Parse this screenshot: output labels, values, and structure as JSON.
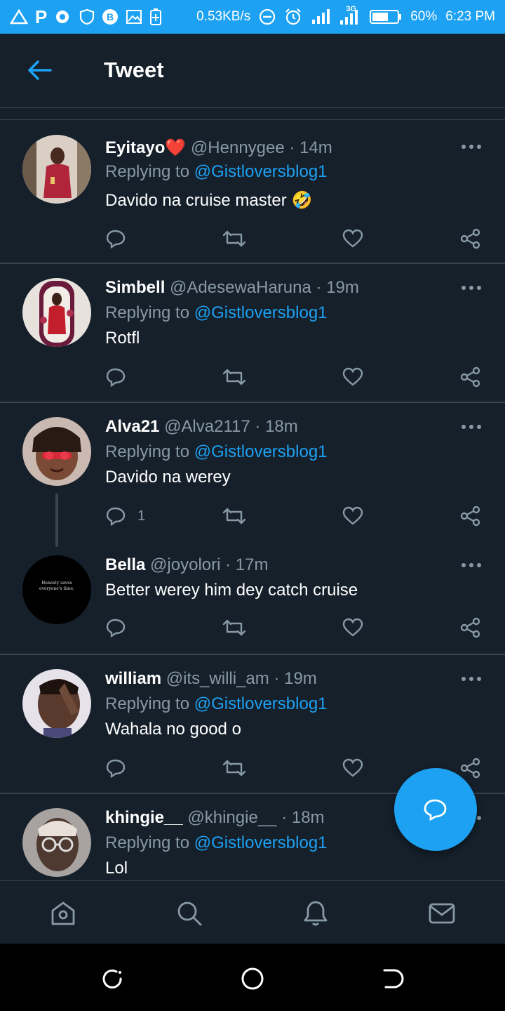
{
  "status_bar": {
    "net_speed": "0.53KB/s",
    "network_type": "3G",
    "battery": "60%",
    "time": "6:23 PM"
  },
  "header": {
    "title": "Tweet"
  },
  "tweets": [
    {
      "name": "Eyitayo❤️",
      "handle": "@Hennygee",
      "time": "14m",
      "replying": "Replying to",
      "mention": "@Gistloversblog1",
      "text": "Davido na cruise master 🤣"
    },
    {
      "name": "Simbell",
      "handle": "@AdesewaHaruna",
      "time": "19m",
      "replying": "Replying to",
      "mention": "@Gistloversblog1",
      "text": "Rotfl"
    },
    {
      "name": "Alva21",
      "handle": "@Alva2117",
      "time": "18m",
      "replying": "Replying to",
      "mention": "@Gistloversblog1",
      "text": "Davido na werey",
      "reply_count": "1"
    },
    {
      "name": "Bella",
      "handle": "@joyolori",
      "time": "17m",
      "text": "Better werey him dey catch cruise",
      "avatar_text": "Henesty saves everyone's time."
    },
    {
      "name": "william",
      "handle": "@its_willi_am",
      "time": "19m",
      "replying": "Replying to",
      "mention": "@Gistloversblog1",
      "text": "Wahala no good o"
    },
    {
      "name": "khingie__",
      "handle": "@khingie__",
      "time": "18m",
      "replying": "Replying to",
      "mention": "@Gistloversblog1",
      "text": "Lol"
    }
  ],
  "separator": "·",
  "colors": {
    "background": "#15202b",
    "accent": "#1da1f2",
    "muted": "#8899a6",
    "divider": "#38444d"
  },
  "icons": {
    "back": "arrow-left-icon",
    "reply": "speech-bubble-icon",
    "retweet": "retweet-icon",
    "like": "heart-icon",
    "share": "share-icon",
    "more": "ellipsis-icon",
    "compose": "compose-reply-icon",
    "home": "home-icon",
    "search": "search-icon",
    "notifications": "bell-icon",
    "messages": "mail-icon"
  }
}
